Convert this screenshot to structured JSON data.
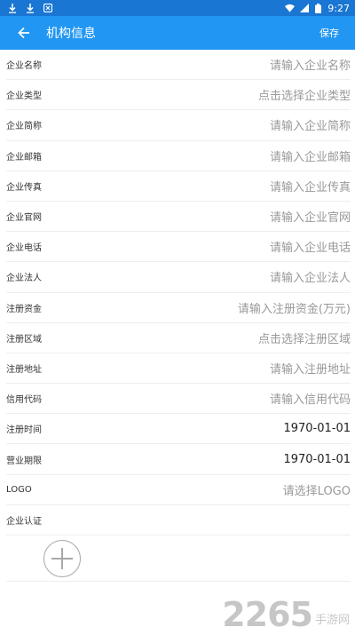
{
  "status_bar": {
    "time": "9:27",
    "icons": [
      "download-icon",
      "download-icon",
      "app-notification-icon",
      "wifi-icon",
      "signal-icon",
      "battery-icon"
    ]
  },
  "app_bar": {
    "title": "机构信息",
    "save_label": "保存",
    "background": "#2196f3"
  },
  "form": {
    "rows": [
      {
        "label": "企业名称",
        "value": "请输入企业名称",
        "filled": false
      },
      {
        "label": "企业类型",
        "value": "点击选择企业类型",
        "filled": false
      },
      {
        "label": "企业简称",
        "value": "请输入企业简称",
        "filled": false
      },
      {
        "label": "企业邮箱",
        "value": "请输入企业邮箱",
        "filled": false
      },
      {
        "label": "企业传真",
        "value": "请输入企业传真",
        "filled": false
      },
      {
        "label": "企业官网",
        "value": "请输入企业官网",
        "filled": false
      },
      {
        "label": "企业电话",
        "value": "请输入企业电话",
        "filled": false
      },
      {
        "label": "企业法人",
        "value": "请输入企业法人",
        "filled": false
      },
      {
        "label": "注册资金",
        "value": "请输入注册资金(万元)",
        "filled": false
      },
      {
        "label": "注册区域",
        "value": "点击选择注册区域",
        "filled": false
      },
      {
        "label": "注册地址",
        "value": "请输入注册地址",
        "filled": false
      },
      {
        "label": "信用代码",
        "value": "请输入信用代码",
        "filled": false
      },
      {
        "label": "注册时间",
        "value": "1970-01-01",
        "filled": true
      },
      {
        "label": "营业期限",
        "value": "1970-01-01",
        "filled": true
      },
      {
        "label": "LOGO",
        "value": "请选择LOGO",
        "filled": false
      }
    ]
  },
  "certification": {
    "label": "企业认证"
  },
  "watermark": {
    "number": "2265",
    "text": "手游网"
  }
}
